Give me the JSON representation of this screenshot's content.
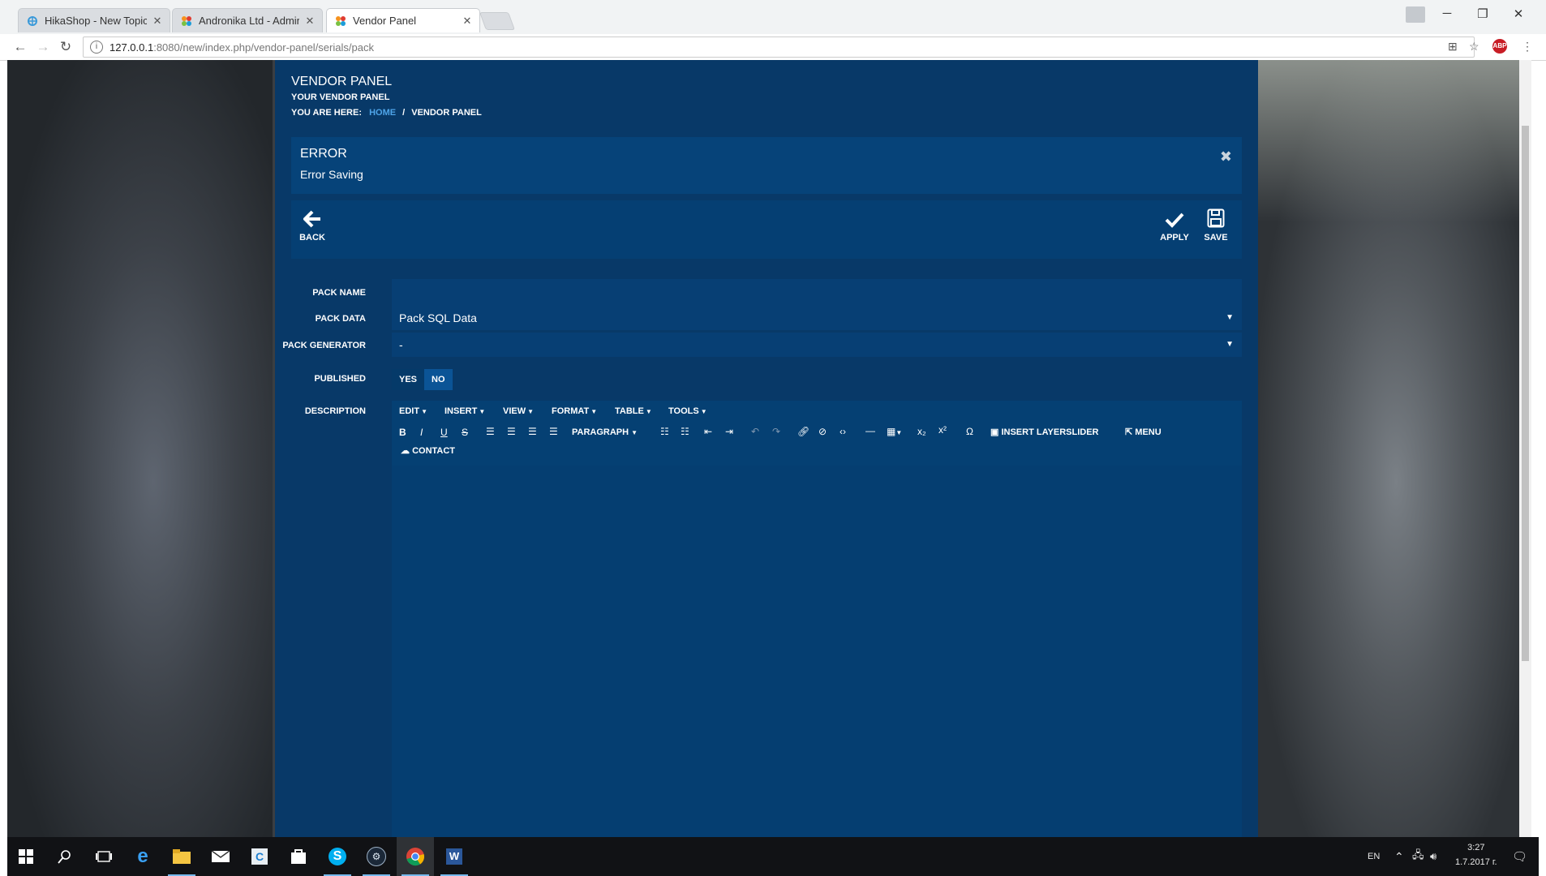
{
  "browser": {
    "tabs": [
      {
        "title": "HikaShop - New Topic - ",
        "active": false
      },
      {
        "title": "Andronika Ltd - Adminis",
        "active": false
      },
      {
        "title": "Vendor Panel",
        "active": true
      }
    ],
    "url_host": "127.0.0.1",
    "url_path": ":8080/new/index.php/vendor-panel/serials/pack",
    "extension_badge": "ABP"
  },
  "page": {
    "title": "VENDOR PANEL",
    "subtitle": "YOUR VENDOR PANEL",
    "breadcrumb_prefix": "YOU ARE HERE:",
    "breadcrumb_home": "HOME",
    "breadcrumb_sep": "/",
    "breadcrumb_current": "VENDOR PANEL"
  },
  "alert": {
    "title": "ERROR",
    "message": "Error Saving"
  },
  "toolbar": {
    "back_label": "BACK",
    "apply_label": "APPLY",
    "save_label": "SAVE"
  },
  "form": {
    "pack_name_label": "PACK NAME",
    "pack_name_value": "",
    "pack_data_label": "PACK DATA",
    "pack_data_value": "Pack SQL Data",
    "pack_generator_label": "PACK GENERATOR",
    "pack_generator_value": "-",
    "published_label": "PUBLISHED",
    "published_yes": "YES",
    "published_no": "NO",
    "published_selected": "NO",
    "description_label": "DESCRIPTION"
  },
  "editor": {
    "menus": [
      "EDIT",
      "INSERT",
      "VIEW",
      "FORMAT",
      "TABLE",
      "TOOLS"
    ],
    "paragraph_label": "PARAGRAPH",
    "insert_layerslider_label": "INSERT LAYERSLIDER",
    "menu_label": "MENU",
    "contact_label": "CONTACT"
  },
  "taskbar": {
    "language": "EN",
    "time": "3:27",
    "date": "1.7.2017 г."
  },
  "colors": {
    "panel": "#06396a",
    "alert_bg": "#064379",
    "link": "#4ea4e8",
    "toggle_selected": "#0b5496"
  }
}
